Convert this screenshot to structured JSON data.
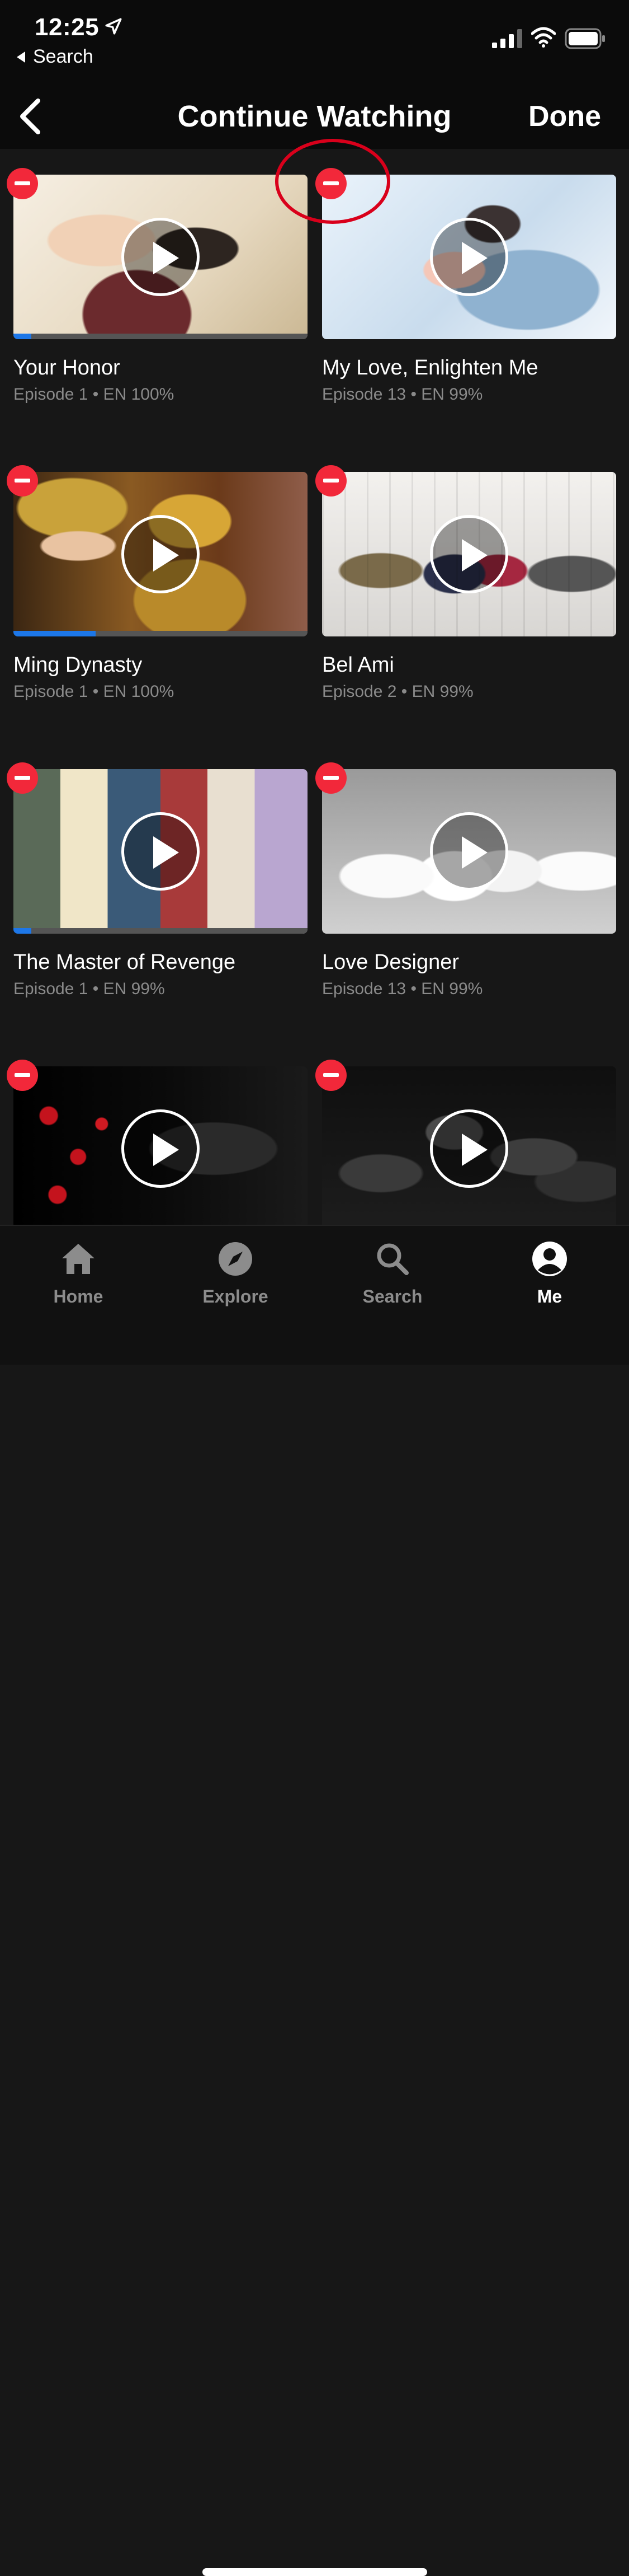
{
  "status_bar": {
    "time": "12:25",
    "back_app": "Search"
  },
  "nav": {
    "title": "Continue Watching",
    "done": "Done"
  },
  "items": [
    {
      "title": "Your Honor",
      "subtitle": "Episode 1 • EN 100%",
      "progress": 0.06
    },
    {
      "title": "My Love, Enlighten Me",
      "subtitle": "Episode 13 • EN 99%",
      "progress": 0
    },
    {
      "title": "Ming Dynasty",
      "subtitle": "Episode 1 • EN 100%",
      "progress": 0.28
    },
    {
      "title": "Bel Ami",
      "subtitle": "Episode 2 • EN 99%",
      "progress": 0
    },
    {
      "title": "The Master of Revenge",
      "subtitle": "Episode 1 • EN 99%",
      "progress": 0.06
    },
    {
      "title": "Love Designer",
      "subtitle": "Episode 13 • EN 99%",
      "progress": 0
    },
    {
      "title": "",
      "subtitle": "",
      "progress": 0
    },
    {
      "title": "",
      "subtitle": "",
      "progress": 0
    }
  ],
  "tabs": [
    {
      "label": "Home",
      "icon": "home-icon",
      "active": false
    },
    {
      "label": "Explore",
      "icon": "compass-icon",
      "active": false
    },
    {
      "label": "Search",
      "icon": "search-icon",
      "active": false
    },
    {
      "label": "Me",
      "icon": "profile-icon",
      "active": true
    }
  ],
  "colors": {
    "remove": "#f2283a",
    "progress": "#1d77e8",
    "highlight": "#d9001b"
  }
}
